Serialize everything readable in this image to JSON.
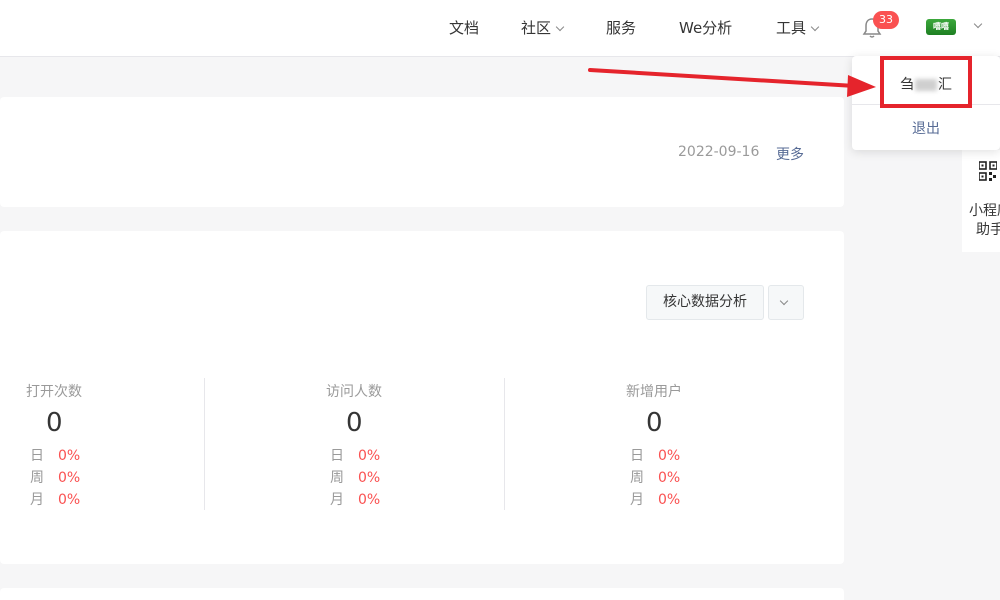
{
  "nav": {
    "items": [
      "文档",
      "社区",
      "服务",
      "We分析",
      "工具"
    ],
    "badge": "33",
    "avatar_text": "嘻嘻"
  },
  "notice": {
    "date": "2022-09-16",
    "more": "更多"
  },
  "analysis": {
    "button": "核心数据分析",
    "stats": [
      {
        "label": "打开次数",
        "value": "0",
        "rows": [
          {
            "k": "日",
            "v": "0%"
          },
          {
            "k": "周",
            "v": "0%"
          },
          {
            "k": "月",
            "v": "0%"
          }
        ]
      },
      {
        "label": "访问人数",
        "value": "0",
        "rows": [
          {
            "k": "日",
            "v": "0%"
          },
          {
            "k": "周",
            "v": "0%"
          },
          {
            "k": "月",
            "v": "0%"
          }
        ]
      },
      {
        "label": "新增用户",
        "value": "0",
        "rows": [
          {
            "k": "日",
            "v": "0%"
          },
          {
            "k": "周",
            "v": "0%"
          },
          {
            "k": "月",
            "v": "0%"
          }
        ]
      }
    ]
  },
  "account_menu": {
    "name_start": "刍",
    "name_end": "汇",
    "logout": "退出"
  },
  "side": {
    "line1": "小程序",
    "line2": "助手"
  },
  "colors": {
    "accent_link": "#576b95",
    "badge_red": "#fa5151",
    "annotation_red": "#e5242c"
  }
}
